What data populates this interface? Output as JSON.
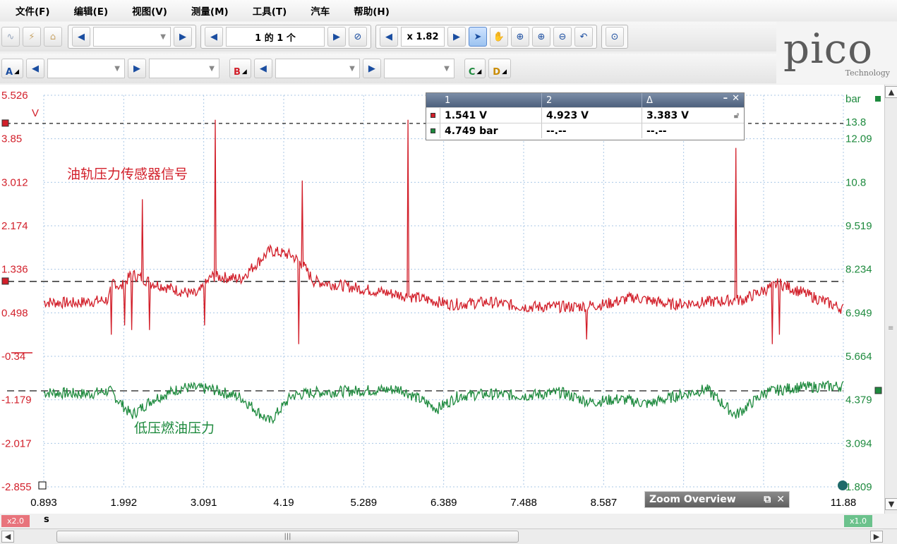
{
  "menu": [
    "文件(F)",
    "编辑(E)",
    "视图(V)",
    "测量(M)",
    "工具(T)",
    "汽车",
    "帮助(H)"
  ],
  "toolbar1": {
    "buffer_nav": "1 的 1 个",
    "zoom_label": "x 1.82"
  },
  "toolbar2": {
    "channel_a": "A",
    "channel_b": "B",
    "channel_c": "C",
    "channel_d": "D"
  },
  "logo": {
    "main": "pico",
    "sub": "Technology"
  },
  "axes": {
    "left_unit": "V",
    "left_ticks": [
      "5.526",
      "3.85",
      "3.012",
      "2.174",
      "1.336",
      "0.498",
      "-0.34",
      "-1.179",
      "-2.017",
      "-2.855"
    ],
    "left_color": "#d21f2a",
    "right_unit": "bar",
    "right_ticks": [
      "13.8",
      "12.09",
      "10.8",
      "9.519",
      "8.234",
      "6.949",
      "5.664",
      "4.379",
      "3.094",
      "1.809"
    ],
    "right_color": "#1e8a3e",
    "x_unit": "s",
    "x_ticks": [
      "0.893",
      "1.992",
      "3.091",
      "4.19",
      "5.289",
      "6.389",
      "7.488",
      "8.587",
      "11.88"
    ]
  },
  "annotations": {
    "red_label": "油轨压力传感器信号",
    "green_label": "低压燃油压力"
  },
  "measurements": {
    "headers": [
      "1",
      "2",
      "Δ"
    ],
    "rows": [
      {
        "v1": "1.541 V",
        "v2": "4.923 V",
        "delta": "3.383 V",
        "color": "#d21f2a"
      },
      {
        "v1": "4.749 bar",
        "v2": "--.--",
        "delta": "--.--",
        "color": "#1e8a3e"
      }
    ]
  },
  "zoom_overview": {
    "title": "Zoom Overview"
  },
  "bottom": {
    "left_badge": "x2.0",
    "right_badge": "x1.0",
    "unit": "s",
    "left_badge_color": "#e8747c",
    "right_badge_color": "#6bc28c"
  },
  "chart_data": {
    "type": "line",
    "x_range": [
      0.893,
      11.88
    ],
    "xlabel": "s",
    "series": [
      {
        "name": "油轨压力传感器信号",
        "unit": "V",
        "axis": "left",
        "ylim": [
          -2.855,
          5.526
        ],
        "x": [
          0.893,
          1.3,
          1.6,
          1.78,
          1.85,
          1.95,
          2.1,
          2.4,
          2.8,
          3.0,
          3.2,
          3.6,
          4.0,
          4.3,
          4.45,
          4.6,
          5.0,
          5.6,
          6.0,
          6.5,
          7.0,
          7.5,
          8.2,
          8.6,
          9.0,
          9.5,
          10.0,
          10.5,
          11.0,
          11.88
        ],
        "values": [
          1.1,
          1.08,
          1.12,
          1.15,
          1.55,
          1.4,
          1.7,
          1.5,
          1.32,
          1.25,
          1.65,
          1.6,
          2.2,
          2.1,
          1.9,
          1.55,
          1.45,
          1.3,
          1.2,
          1.05,
          1.1,
          1.0,
          1.0,
          1.05,
          1.2,
          1.05,
          1.1,
          1.15,
          1.5,
          0.95
        ]
      },
      {
        "name": "低压燃油压力",
        "unit": "bar",
        "axis": "right",
        "ylim": [
          1.809,
          13.8
        ],
        "x": [
          0.893,
          1.5,
          1.8,
          2.1,
          2.4,
          2.8,
          3.2,
          3.6,
          4.0,
          4.3,
          4.6,
          5.2,
          5.8,
          6.3,
          6.6,
          7.0,
          7.5,
          8.0,
          8.4,
          8.8,
          9.2,
          9.6,
          10.0,
          10.4,
          10.8,
          11.2,
          11.88
        ],
        "values": [
          4.7,
          4.65,
          4.75,
          4.0,
          4.5,
          4.85,
          4.8,
          4.55,
          3.8,
          4.6,
          4.7,
          4.75,
          4.8,
          4.2,
          4.6,
          4.65,
          4.6,
          4.7,
          4.4,
          4.5,
          4.35,
          4.6,
          4.8,
          4.0,
          4.7,
          4.85,
          4.9
        ]
      }
    ],
    "rulers": [
      {
        "axis": "left",
        "value": 4.923
      },
      {
        "axis": "left",
        "value": 1.541
      },
      {
        "axis": "right",
        "value": 4.749
      }
    ],
    "grid": true
  }
}
